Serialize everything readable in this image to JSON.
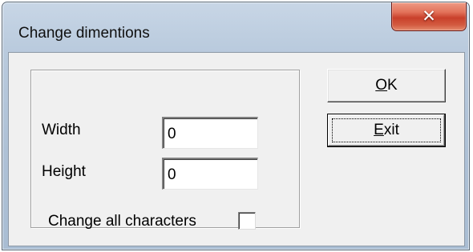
{
  "window": {
    "title": "Change dimentions",
    "close_icon": "close-icon",
    "close_glyph": "✕"
  },
  "form": {
    "width_label": "Width",
    "width_value": "0",
    "height_label": "Height",
    "height_value": "0",
    "change_all_label": "Change all characters",
    "change_all_checked": false
  },
  "buttons": {
    "ok": {
      "mnemonic": "O",
      "rest": "K"
    },
    "exit": {
      "mnemonic": "E",
      "rest": "xit"
    }
  },
  "colors": {
    "close_button": "#c9402b",
    "client_background": "#f0f0f0"
  }
}
